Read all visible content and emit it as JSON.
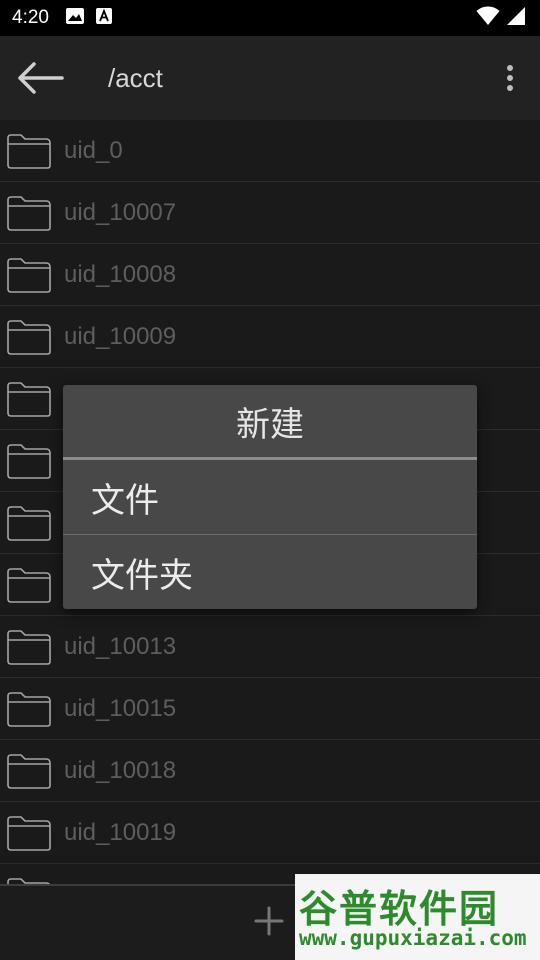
{
  "status_bar": {
    "time": "4:20",
    "icons_left": [
      "image-icon",
      "font-a-icon"
    ],
    "icons_right": [
      "wifi-icon",
      "cell-signal-icon"
    ]
  },
  "toolbar": {
    "path": "/acct",
    "back_icon": "arrow-left-icon",
    "menu_icon": "more-vert-icon"
  },
  "files": [
    "uid_0",
    "uid_10007",
    "uid_10008",
    "uid_10009",
    "",
    "",
    "",
    "",
    "uid_10013",
    "uid_10015",
    "uid_10018",
    "uid_10019",
    ""
  ],
  "dialog": {
    "title": "新建",
    "options": [
      "文件",
      "文件夹"
    ]
  },
  "bottom_bar": {
    "add_icon": "plus-icon"
  },
  "watermark": {
    "title": "谷普软件园",
    "url": "www.gupuxiazai.com"
  },
  "colors": {
    "background": "#1a1a1a",
    "dialog": "#484848",
    "text_dim": "#5e5e5e"
  }
}
